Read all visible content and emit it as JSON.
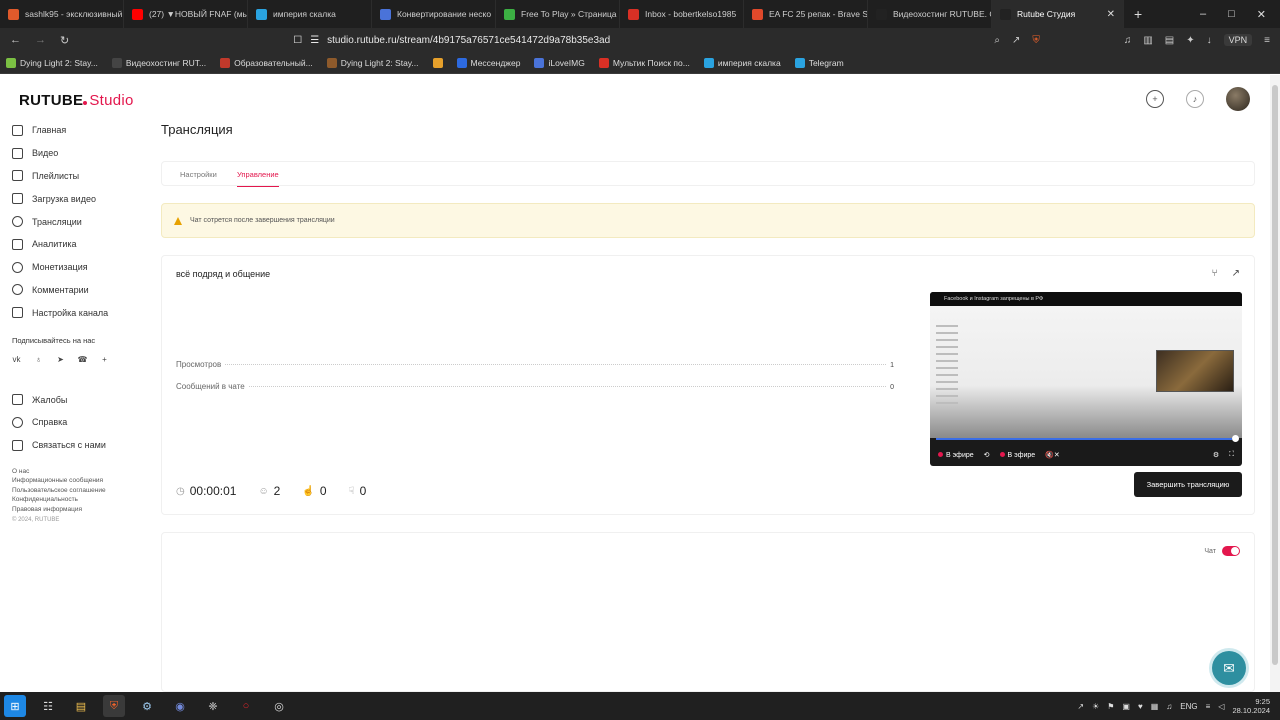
{
  "browser": {
    "tabs": [
      {
        "label": "sashlk95 - эксклюзивный",
        "color": "#e05a2b"
      },
      {
        "label": "(27) ▼НОВЫЙ FNAF (мы",
        "color": "#ff0000"
      },
      {
        "label": "империя скалка",
        "color": "#2aa3e0"
      },
      {
        "label": "Конвертирование неско",
        "color": "#4a73d9"
      },
      {
        "label": "Free To Play » Страница 8",
        "color": "#3cb043"
      },
      {
        "label": "Inbox - bobertkelso1985",
        "color": "#d93025"
      },
      {
        "label": "EA FC 25 репак - Brave S",
        "color": "#e0492b"
      },
      {
        "label": "Видеохостинг RUTUBE. С",
        "color": "#222222"
      },
      {
        "label": "Rutube Студия",
        "color": "#222222",
        "active": true
      }
    ],
    "url": "studio.rutube.ru/stream/4b9175a76571ce541472d9a78b35e3ad",
    "vpn_label": "VPN",
    "bookmarks": [
      {
        "label": "Dying Light 2: Stay...",
        "color": "#7bc043"
      },
      {
        "label": "Видеохостинг RUT...",
        "color": "#444444"
      },
      {
        "label": "Образовательный...",
        "color": "#c0392b"
      },
      {
        "label": "Dying Light 2: Stay...",
        "color": "#8e5a2b"
      },
      {
        "label": "",
        "color": "#e6a02b"
      },
      {
        "label": "Мессенджер",
        "color": "#2d6ae0"
      },
      {
        "label": "iLoveIMG",
        "color": "#4a73d9"
      },
      {
        "label": "Мультик Поиск по...",
        "color": "#d93025"
      },
      {
        "label": "империя скалка",
        "color": "#2aa3e0"
      },
      {
        "label": "Telegram",
        "color": "#2aa3e0"
      }
    ]
  },
  "app": {
    "logo": "RUTUBE",
    "logo_suffix": "Studio",
    "brand_color": "#e3174d"
  },
  "sidebar": {
    "items": [
      {
        "label": "Главная",
        "icon": "home-icon"
      },
      {
        "label": "Видео",
        "icon": "video-icon"
      },
      {
        "label": "Плейлисты",
        "icon": "playlist-icon"
      },
      {
        "label": "Загрузка видео",
        "icon": "upload-icon"
      },
      {
        "label": "Трансляции",
        "icon": "broadcast-icon"
      },
      {
        "label": "Аналитика",
        "icon": "analytics-icon"
      },
      {
        "label": "Монетизация",
        "icon": "monetization-icon"
      },
      {
        "label": "Комментарии",
        "icon": "comments-icon"
      },
      {
        "label": "Настройка канала",
        "icon": "channel-settings-icon"
      }
    ],
    "subscribe_label": "Подписывайтесь на нас",
    "socials": [
      "vk",
      "ok",
      "telegram",
      "viber",
      "more"
    ],
    "secondary": [
      {
        "label": "Жалобы",
        "icon": "flag-icon"
      },
      {
        "label": "Справка",
        "icon": "help-icon"
      },
      {
        "label": "Связаться с нами",
        "icon": "contact-icon"
      }
    ],
    "footer_links": [
      "О нас",
      "Информационные сообщения",
      "Пользовательское соглашение",
      "Конфиденциальность",
      "Правовая информация"
    ],
    "copyright": "© 2024, RUTUBE"
  },
  "main": {
    "title": "Трансляция",
    "tabs": [
      {
        "label": "Настройки",
        "active": false
      },
      {
        "label": "Управление",
        "active": true
      }
    ],
    "warning": "Чат сотрется после завершения трансляции",
    "stream": {
      "title": "всё подряд и общение",
      "stats": [
        {
          "label": "Просмотров",
          "value": "1"
        },
        {
          "label": "Сообщений в чате",
          "value": "0"
        }
      ],
      "duration": "00:00:01",
      "viewers": "2",
      "likes": "0",
      "dislikes": "0",
      "player": {
        "preview_title": "Facebook и Instagram запрещены в РФ",
        "live_label": "В эфире",
        "live_label_2": "В эфире",
        "progress": 1.0
      },
      "end_button": "Завершить трансляцию"
    },
    "chat": {
      "toggle_label": "Чат",
      "enabled": true
    }
  },
  "taskbar": {
    "lang": "ENG",
    "time": "9:25",
    "date": "28.10.2024"
  }
}
